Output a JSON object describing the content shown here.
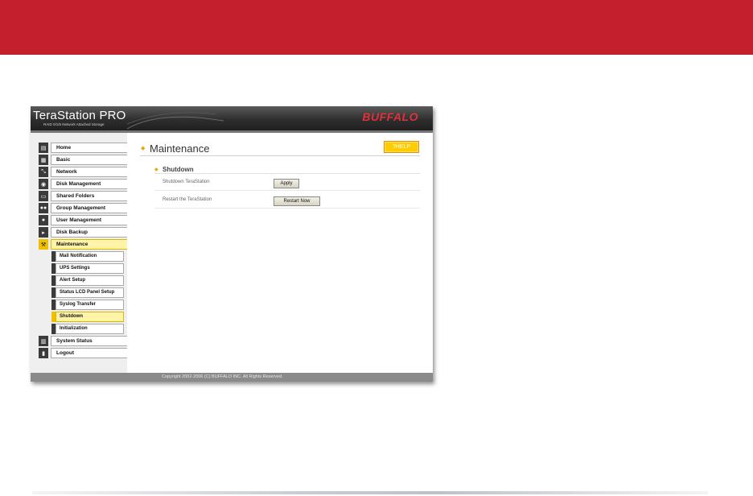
{
  "app": {
    "title": "TeraStation PRO",
    "subtitle": "RAID 0/1/5 Network Attached Storage",
    "brand": "BUFFALO"
  },
  "nav": {
    "items": [
      {
        "label": "Home",
        "icon": "home-icon"
      },
      {
        "label": "Basic",
        "icon": "document-icon"
      },
      {
        "label": "Network",
        "icon": "network-icon"
      },
      {
        "label": "Disk Management",
        "icon": "disk-icon"
      },
      {
        "label": "Shared Folders",
        "icon": "folder-icon"
      },
      {
        "label": "Group Management",
        "icon": "group-icon"
      },
      {
        "label": "User Management",
        "icon": "user-icon"
      },
      {
        "label": "Disk Backup",
        "icon": "backup-icon"
      },
      {
        "label": "Maintenance",
        "icon": "tools-icon"
      }
    ],
    "sub_items": [
      "Mail Notification",
      "UPS Settings",
      "Alert Setup",
      "Status LCD Panel Setup",
      "Syslog Transfer",
      "Shutdown",
      "Initialization"
    ],
    "bottom_items": [
      {
        "label": "System Status",
        "icon": "status-icon"
      },
      {
        "label": "Logout",
        "icon": "logout-icon"
      }
    ]
  },
  "main": {
    "page_title": "Maintenance",
    "help_label": "?HELP",
    "section_title": "Shutdown",
    "rows": [
      {
        "label": "Shutdown TeraStation",
        "button": "Apply"
      },
      {
        "label": "Restart the TeraStation",
        "button": "Restart Now"
      }
    ]
  },
  "footer": {
    "copyright": "Copyright 2002-2006 (C) BUFFALO INC. All Rights Reserved."
  },
  "colors": {
    "top_band": "#c41f2d",
    "accent_yellow": "#ffcc00",
    "brand_red": "#e0303a"
  }
}
